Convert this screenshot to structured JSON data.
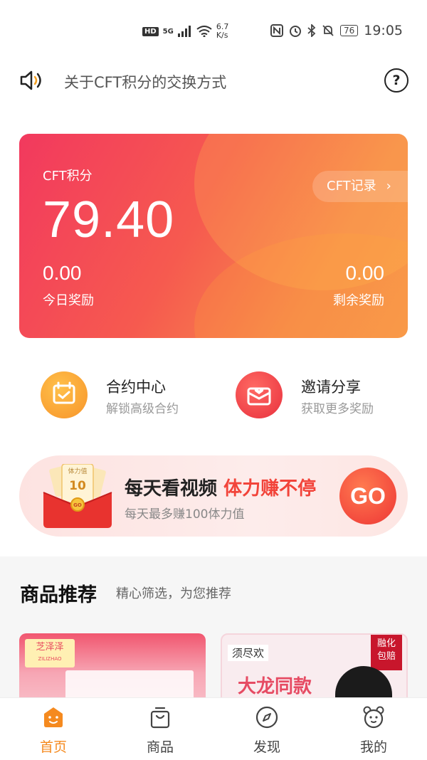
{
  "status_bar": {
    "hd": "HD",
    "network": "5G",
    "speed_value": "6.7",
    "speed_unit": "K/s",
    "battery": "76",
    "time": "19:05"
  },
  "notice": {
    "text": "关于CFT积分的交换方式",
    "help_glyph": "?"
  },
  "points_card": {
    "label": "CFT积分",
    "value": "79.40",
    "record_label": "CFT记录",
    "record_chevron": "›",
    "today_value": "0.00",
    "today_label": "今日奖励",
    "remaining_value": "0.00",
    "remaining_label": "剩余奖励",
    "colors": {
      "gradient_start": "#f2395e",
      "gradient_end": "#f8964c"
    }
  },
  "shortcuts": [
    {
      "title": "合约中心",
      "subtitle": "解锁高级合约",
      "icon": "calendar-check-icon",
      "color": "#f7a02e"
    },
    {
      "title": "邀请分享",
      "subtitle": "获取更多奖励",
      "icon": "envelope-heart-icon",
      "color": "#ef3b45"
    }
  ],
  "video_banner": {
    "title_part1": "每天看视频",
    "title_part2": "体力赚不停",
    "subtitle": "每天最多赚100体力值",
    "go_label": "GO",
    "card_title": "体力值",
    "card_value": "10",
    "coin_label": "GO"
  },
  "recommend": {
    "title": "商品推荐",
    "subtitle": "精心筛选，为您推荐",
    "products": [
      {
        "logo": "芝泽泽",
        "brand_sub": "ZILIZHAO"
      },
      {
        "logo": "须尽欢",
        "badge_line1": "融化",
        "badge_line2": "包赔",
        "headline": "大龙同款"
      }
    ]
  },
  "tabbar": {
    "accent_color": "#f58a1f",
    "tabs": [
      {
        "label": "首页",
        "icon": "home-face-icon",
        "active": true
      },
      {
        "label": "商品",
        "icon": "shopping-bag-icon",
        "active": false
      },
      {
        "label": "发现",
        "icon": "compass-icon",
        "active": false
      },
      {
        "label": "我的",
        "icon": "bear-face-icon",
        "active": false
      }
    ]
  }
}
